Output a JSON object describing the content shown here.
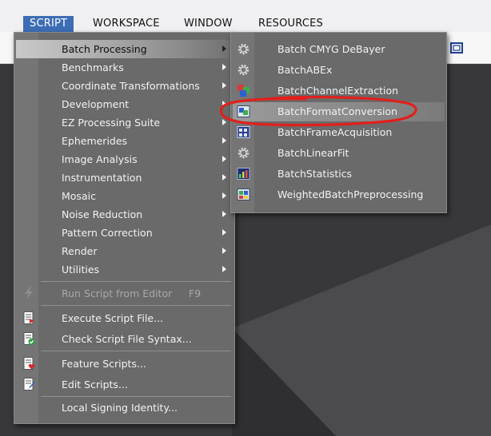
{
  "menubar": {
    "items": [
      {
        "label": "SCRIPT",
        "active": true
      },
      {
        "label": "WORKSPACE",
        "active": false
      },
      {
        "label": "WINDOW",
        "active": false
      },
      {
        "label": "RESOURCES",
        "active": false
      }
    ]
  },
  "script_menu": {
    "items": [
      {
        "label": "Batch Processing",
        "submenu": true
      },
      {
        "label": "Benchmarks",
        "submenu": true
      },
      {
        "label": "Coordinate Transformations",
        "submenu": true
      },
      {
        "label": "Development",
        "submenu": true
      },
      {
        "label": "EZ Processing Suite",
        "submenu": true
      },
      {
        "label": "Ephemerides",
        "submenu": true
      },
      {
        "label": "Image Analysis",
        "submenu": true
      },
      {
        "label": "Instrumentation",
        "submenu": true
      },
      {
        "label": "Mosaic",
        "submenu": true
      },
      {
        "label": "Noise Reduction",
        "submenu": true
      },
      {
        "label": "Pattern Correction",
        "submenu": true
      },
      {
        "label": "Render",
        "submenu": true
      },
      {
        "label": "Utilities",
        "submenu": true
      }
    ],
    "run_from_editor": {
      "label": "Run Script from Editor",
      "shortcut": "F9",
      "icon": "lightning-icon"
    },
    "execute_file": {
      "label": "Execute Script File...",
      "icon": "script-execute-icon"
    },
    "check_syntax": {
      "label": "Check Script File Syntax...",
      "icon": "script-check-icon"
    },
    "feature_scripts": {
      "label": "Feature Scripts...",
      "icon": "script-feature-icon"
    },
    "edit_scripts": {
      "label": "Edit Scripts...",
      "icon": "script-edit-icon"
    },
    "signing_identity": {
      "label": "Local Signing Identity..."
    }
  },
  "batch_submenu": {
    "items": [
      {
        "label": "Batch CMYG DeBayer",
        "icon": "gear-icon"
      },
      {
        "label": "BatchABEx",
        "icon": "gear-icon"
      },
      {
        "label": "BatchChannelExtraction",
        "icon": "channel-extraction-icon"
      },
      {
        "label": "BatchFormatConversion",
        "icon": "format-conversion-icon"
      },
      {
        "label": "BatchFrameAcquisition",
        "icon": "frame-acquisition-icon"
      },
      {
        "label": "BatchLinearFit",
        "icon": "gear-icon"
      },
      {
        "label": "BatchStatistics",
        "icon": "statistics-icon"
      },
      {
        "label": "WeightedBatchPreprocessing",
        "icon": "preprocessing-icon"
      }
    ],
    "highlighted": "BatchFormatConversion"
  },
  "colors": {
    "menu_bg": "#6a6a6a",
    "menu_text": "#f2f2f2",
    "active_menubar": "#3d6db5",
    "annotation": "#e0201c"
  }
}
